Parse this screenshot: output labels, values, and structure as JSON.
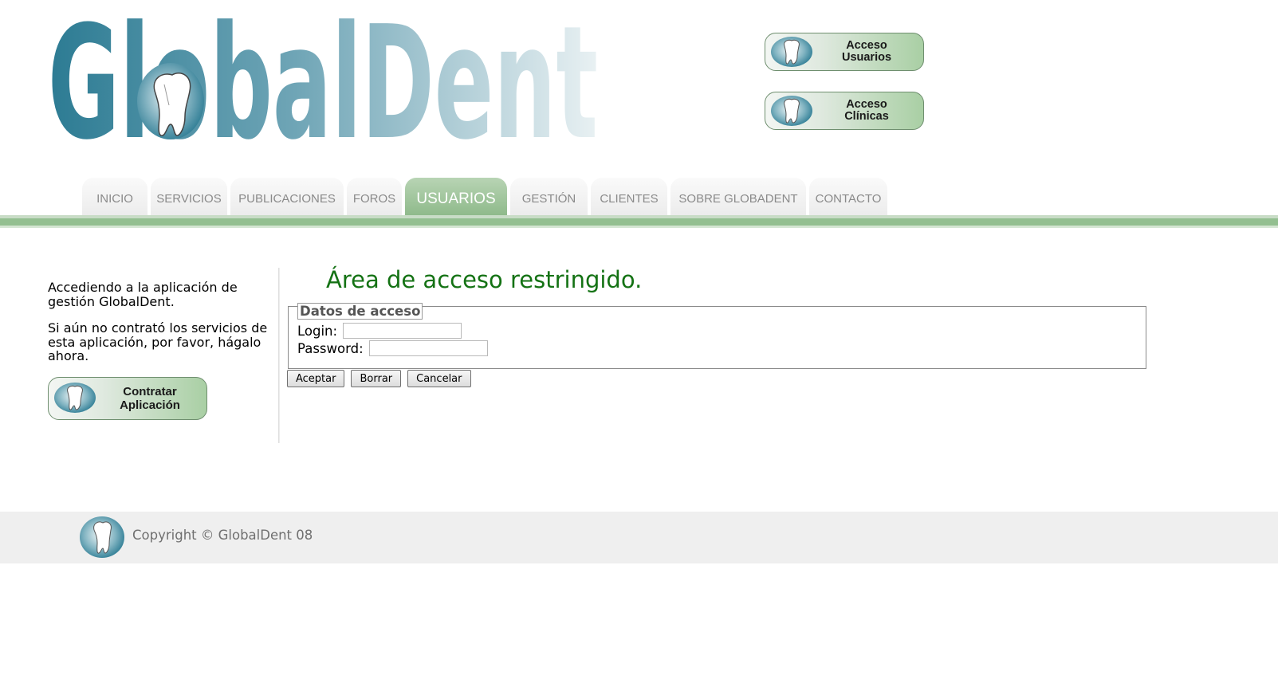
{
  "logo": {
    "text": "GlobalDent"
  },
  "access_buttons": [
    {
      "line1": "Acceso",
      "line2": "Usuarios"
    },
    {
      "line1": "Acceso",
      "line2": "Clínicas"
    }
  ],
  "nav": {
    "active": "USUARIOS",
    "items": [
      {
        "label": "INICIO"
      },
      {
        "label": "SERVICIOS"
      },
      {
        "label": "PUBLICACIONES"
      },
      {
        "label": "FOROS"
      },
      {
        "label": "USUARIOS"
      },
      {
        "label": "GESTIÓN"
      },
      {
        "label": "CLIENTES"
      },
      {
        "label": "SOBRE GLOBADENT"
      },
      {
        "label": "CONTACTO"
      }
    ]
  },
  "sidebar": {
    "para1": "Accediendo a la aplicación de gestión GlobalDent.",
    "para2": "Si aún no contrató los servicios de esta aplicación, por favor, hágalo ahora.",
    "contract_button": {
      "line1": "Contratar",
      "line2": "Aplicación"
    }
  },
  "main": {
    "title": "Área de acceso restringido.",
    "fieldset_legend": "Datos de acceso",
    "login_label": "Login:",
    "login_value": "",
    "password_label": "Password:",
    "password_value": "",
    "buttons": {
      "accept": "Aceptar",
      "clear": "Borrar",
      "cancel": "Cancelar"
    }
  },
  "footer": {
    "copyright": "Copyright © GlobalDent 08"
  },
  "colors": {
    "accent_green": "#93bf90",
    "title_green": "#147214",
    "logo_teal": "#2c7b93"
  },
  "icons": {
    "tooth": "tooth-icon"
  }
}
